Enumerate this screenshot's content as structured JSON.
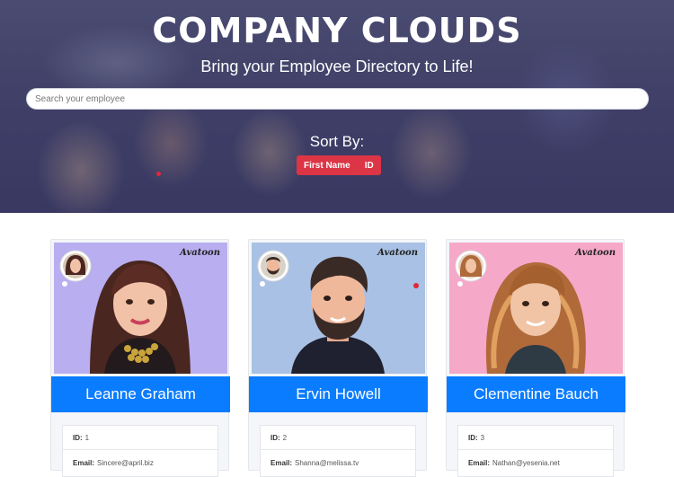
{
  "header": {
    "title": "COMPANY CLOUDS",
    "subtitle": "Bring your Employee Directory to Life!"
  },
  "search": {
    "placeholder": "Search your employee",
    "value": ""
  },
  "sort": {
    "label": "Sort By:",
    "buttons": [
      "First Name",
      "ID"
    ],
    "color": "#dc3545"
  },
  "colors": {
    "name_bar": "#0a7cff"
  },
  "employees": [
    {
      "name": "Leanne Graham",
      "id_label": "ID:",
      "id": "1",
      "email_label": "Email:",
      "email": "Sincere@april.biz",
      "photo_bg": "#b9aef0",
      "brand": "Avatoon"
    },
    {
      "name": "Ervin Howell",
      "id_label": "ID:",
      "id": "2",
      "email_label": "Email:",
      "email": "Shanna@melissa.tv",
      "photo_bg": "#a9c1e4",
      "brand": "Avatoon"
    },
    {
      "name": "Clementine Bauch",
      "id_label": "ID:",
      "id": "3",
      "email_label": "Email:",
      "email": "Nathan@yesenia.net",
      "photo_bg": "#f5a8c8",
      "brand": "Avatoon"
    }
  ]
}
